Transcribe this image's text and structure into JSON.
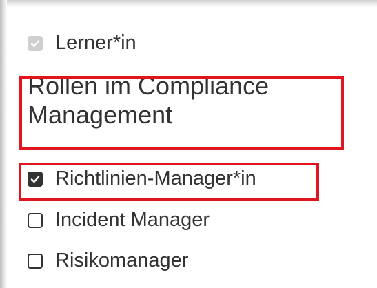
{
  "options_top": [
    {
      "label": "Lerner*in",
      "state": "checked-disabled"
    }
  ],
  "section": {
    "title": "Rollen im Compliance Management"
  },
  "options": [
    {
      "label": "Richtlinien-Manager*in",
      "state": "checked"
    },
    {
      "label": "Incident Manager",
      "state": "unchecked"
    },
    {
      "label": "Risikomanager",
      "state": "unchecked"
    }
  ],
  "colors": {
    "highlight_border": "#e0151f",
    "text": "#333333",
    "disabled_checkbox": "#cfcfcf"
  }
}
